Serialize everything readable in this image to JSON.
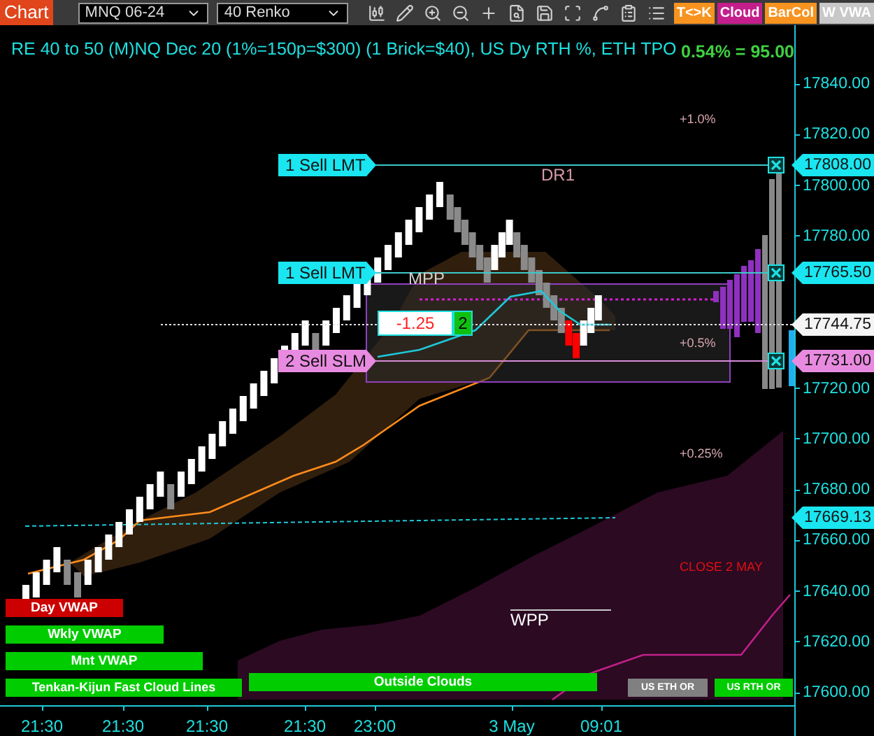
{
  "toolbar": {
    "title": "Chart",
    "symbol": "MNQ 06-24",
    "interval": "40 Renko",
    "buttons": [
      {
        "label": "T<>K",
        "color": "#f7931e"
      },
      {
        "label": "Cloud",
        "color": "#c41e8c"
      },
      {
        "label": "BarCol",
        "color": "#f7931e"
      },
      {
        "label": "W VWA",
        "color": "#c8c8c8"
      }
    ]
  },
  "chart": {
    "title": "RE 40 to 50 (M)NQ Dec 20 (1%=150p=$300) (1 Brick=$40), US Dy RTH %, ETH TPO",
    "change": "0.54% = 95.00",
    "orders": [
      {
        "label": "1 Sell LMT",
        "price": "17808.00",
        "kind": "limit"
      },
      {
        "label": "1 Sell LMT",
        "price": "17765.50",
        "kind": "limit"
      },
      {
        "label": "2 Sell SLM",
        "price": "17731.00",
        "kind": "stop"
      }
    ],
    "position": {
      "pnl": "-1.25",
      "quantity": "2"
    },
    "last_price": "17744.75",
    "vwap_price": "17669.13",
    "annotations": [
      {
        "text": "+1.0%",
        "color": "#d8a8b0"
      },
      {
        "text": "DR1",
        "color": "#d89aa8"
      },
      {
        "text": "MPP",
        "color": "#d0d0d0"
      },
      {
        "text": "+0.5%",
        "color": "#d8a8b0"
      },
      {
        "text": "+0.25%",
        "color": "#d8a8b0"
      },
      {
        "text": "CLOSE 2 MAY",
        "color": "#e01010"
      },
      {
        "text": "WPP",
        "color": "#ffffff"
      }
    ],
    "indicators": [
      {
        "label": "Day VWAP",
        "color": "#cc0000"
      },
      {
        "label": "Wkly VWAP",
        "color": "#00cc00"
      },
      {
        "label": "Mnt VWAP",
        "color": "#00cc00"
      },
      {
        "label": "Tenkan-Kijun Fast Cloud Lines",
        "color": "#00cc00"
      },
      {
        "label": "Outside Clouds",
        "color": "#00cc00"
      },
      {
        "label": "US ETH OR",
        "color": "#808080"
      },
      {
        "label": "US RTH OR",
        "color": "#00cc00"
      }
    ],
    "y_ticks": [
      "17840.00",
      "17820.00",
      "17800.00",
      "17780.00",
      "17720.00",
      "17700.00",
      "17680.00",
      "17660.00",
      "17640.00",
      "17620.00",
      "17600.00"
    ],
    "x_ticks": [
      "21:30",
      "21:30",
      "21:30",
      "21:30",
      "23:00",
      "3 May",
      "09:01"
    ]
  }
}
